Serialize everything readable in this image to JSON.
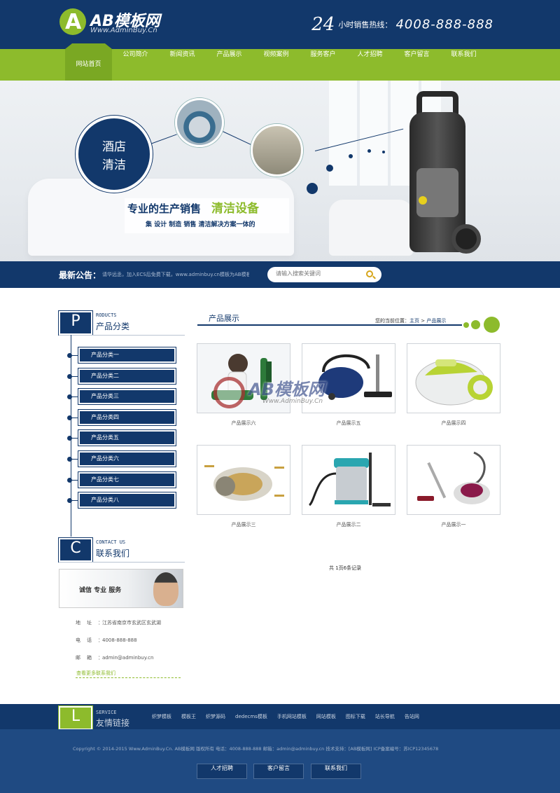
{
  "header": {
    "logo_text": "AB模板网",
    "logo_sub": "Www.AdminBuy.Cn",
    "hotline_24": "24",
    "hotline_label": "小时销售热线：",
    "hotline_number": "4008-888-888"
  },
  "nav": {
    "items": [
      "网站首页",
      "公司简介",
      "新闻资讯",
      "产品展示",
      "视频案例",
      "服务客户",
      "人才招聘",
      "客户留言",
      "联系我们"
    ],
    "active": "网站首页"
  },
  "banner": {
    "circle_text_1": "酒店",
    "circle_text_2": "清洁",
    "slogan_main": "专业的生产销售",
    "slogan_highlight": "清洁设备",
    "slogan_sub": "集 设计  制造  销售  清洁解决方案一体的"
  },
  "notice": {
    "label": "最新公告：",
    "text": "请华远丞，加入ECS后免费下载，www.adminbuy.cn模板为AB模板",
    "search_placeholder": "请输入搜索关键词"
  },
  "sidebar": {
    "products": {
      "letter": "P",
      "en": "RODUCTS",
      "cn": "产品分类",
      "items": [
        "产品分类一",
        "产品分类二",
        "产品分类三",
        "产品分类四",
        "产品分类五",
        "产品分类六",
        "产品分类七",
        "产品分类八"
      ]
    },
    "contact": {
      "letter": "C",
      "en": "CONTACT US",
      "cn": "联系我们",
      "image_text": "诚信  专业  服务",
      "address_label": "地址：",
      "address": "江苏省南京市玄武区玄武湖",
      "phone_label": "电话：",
      "phone": "4008-888-888",
      "email_label": "邮箱：",
      "email": "admin@adminbuy.cn",
      "more": "查看更多联系我们"
    }
  },
  "products": {
    "title": "产品展示",
    "breadcrumb_prefix": "您的当前位置：",
    "breadcrumb_home": "主页",
    "breadcrumb_sep": " > ",
    "breadcrumb_current": "产品展示",
    "items": [
      {
        "name": "产品展示六"
      },
      {
        "name": "产品展示五"
      },
      {
        "name": "产品展示四"
      },
      {
        "name": "产品展示三"
      },
      {
        "name": "产品展示二"
      },
      {
        "name": "产品展示一"
      }
    ],
    "pagination": "共 1页6条记录",
    "watermark_text": "AB模板网",
    "watermark_sub": "Www.AdminBuy.Cn"
  },
  "footer": {
    "links_letter": "L",
    "links_en": "SERVICE",
    "links_cn": "友情链接",
    "links": [
      "织梦模板",
      "模板王",
      "织梦源码",
      "dedecms模板",
      "手机网站模板",
      "网站模板",
      "图标下载",
      "站长导航",
      "告站网"
    ],
    "copyright": "Copyright © 2014-2015 Www.AdminBuy.Cn. AB模板网 版权所有   电话：4008-888-888   邮箱：admin@adminbuy.cn   技术支持：[AB模板网]   ICP备案编号：苏ICP12345678",
    "buttons": [
      "人才招聘",
      "客户留言",
      "联系我们"
    ]
  }
}
